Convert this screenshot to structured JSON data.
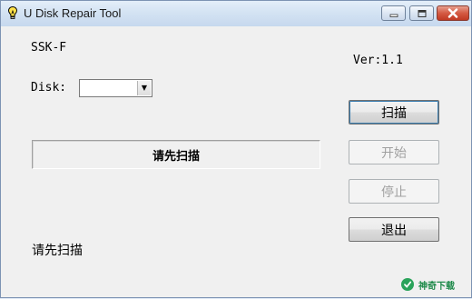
{
  "window": {
    "title": "U Disk Repair Tool",
    "icon": "lightbulb-icon",
    "controls": {
      "minimize_icon": "minimize-icon",
      "maximize_icon": "maximize-icon",
      "close_icon": "close-icon"
    }
  },
  "device_model": "SSK-F",
  "version": "Ver:1.1",
  "disk": {
    "label": "Disk:",
    "selected_value": ""
  },
  "status_panel_text": "请先扫描",
  "buttons": {
    "scan": "扫描",
    "start": "开始",
    "stop": "停止",
    "exit": "退出"
  },
  "bottom_status": "请先扫描",
  "watermark": {
    "text": "神奇下载",
    "color": "#1e8a4a"
  },
  "colors": {
    "titlebar": "#d4e3f3",
    "close_button": "#d45a43",
    "disabled_text": "#a0a0a0"
  }
}
